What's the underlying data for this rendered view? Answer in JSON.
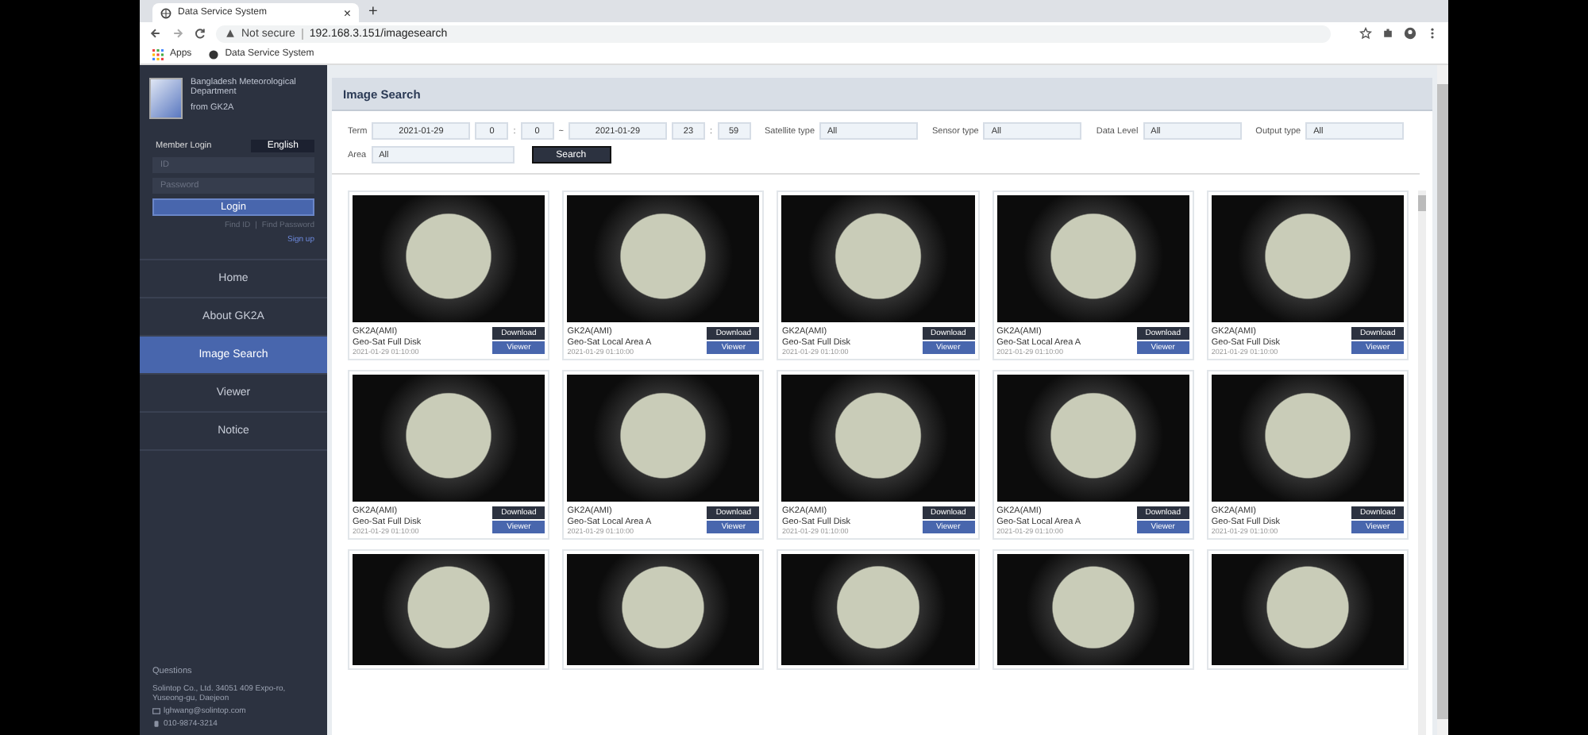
{
  "browser": {
    "tab_title": "Data Service System",
    "tab_close": "×",
    "new_tab": "+",
    "security": "Not secure",
    "url": "192.168.3.151/imagesearch",
    "bookmarks": [
      "Apps",
      "Data Service System"
    ]
  },
  "sidebar": {
    "org": "Bangladesh Meteorological Department",
    "sub": "from GK2A",
    "login_title": "Member Login",
    "language": "English",
    "id_placeholder": "ID",
    "password_placeholder": "Password",
    "login_button": "Login",
    "find_id": "Find ID",
    "find_sep": "|",
    "find_password": "Find Password",
    "sign_up": "Sign up",
    "menu": [
      {
        "label": "Home",
        "selected": false
      },
      {
        "label": "About GK2A",
        "selected": false
      },
      {
        "label": "Image Search",
        "selected": true
      },
      {
        "label": "Viewer",
        "selected": false
      },
      {
        "label": "Notice",
        "selected": false
      }
    ],
    "footer": {
      "title": "Questions",
      "address": "Solintop Co., Ltd. 34051 409 Expo-ro, Yuseong-gu, Daejeon",
      "email": "lghwang@solintop.com",
      "phone": "010-9874-3214"
    }
  },
  "main": {
    "title": "Image Search",
    "form": {
      "term_label": "Term",
      "start_date": "2021-01-29",
      "start_hour": "0",
      "start_min": "0",
      "range_sep": "~",
      "end_date": "2021-01-29",
      "end_hour": "23",
      "end_min": "59",
      "time_sep": ":",
      "selects": [
        {
          "label": "Satellite type",
          "value": "All"
        },
        {
          "label": "Sensor type",
          "value": "All"
        },
        {
          "label": "Data Level",
          "value": "All"
        },
        {
          "label": "Output type",
          "value": "All"
        }
      ],
      "area_label": "Area",
      "area_value": "All",
      "search_button": "Search"
    },
    "cards": [
      {
        "kind": "full",
        "sensor": "GK2A(AMI)",
        "area": "Geo-Sat Full Disk",
        "time": "2021-01-29 01:10:00",
        "download": "Download",
        "viewer": "Viewer"
      },
      {
        "kind": "full",
        "sensor": "GK2A(AMI)",
        "area": "Geo-Sat Local Area A",
        "time": "2021-01-29 01:10:00",
        "download": "Download",
        "viewer": "Viewer"
      },
      {
        "kind": "full",
        "sensor": "GK2A(AMI)",
        "area": "Geo-Sat Full Disk",
        "time": "2021-01-29 01:10:00",
        "download": "Download",
        "viewer": "Viewer"
      },
      {
        "kind": "full",
        "sensor": "GK2A(AMI)",
        "area": "Geo-Sat Local Area A",
        "time": "2021-01-29 01:10:00",
        "download": "Download",
        "viewer": "Viewer"
      },
      {
        "kind": "full",
        "sensor": "GK2A(AMI)",
        "area": "Geo-Sat Full Disk",
        "time": "2021-01-29 01:10:00",
        "download": "Download",
        "viewer": "Viewer"
      },
      {
        "kind": "full",
        "sensor": "GK2A(AMI)",
        "area": "Geo-Sat Full Disk",
        "time": "2021-01-29 01:10:00",
        "download": "Download",
        "viewer": "Viewer"
      },
      {
        "kind": "full",
        "sensor": "GK2A(AMI)",
        "area": "Geo-Sat Local Area A",
        "time": "2021-01-29 01:10:00",
        "download": "Download",
        "viewer": "Viewer"
      },
      {
        "kind": "full",
        "sensor": "GK2A(AMI)",
        "area": "Geo-Sat Full Disk",
        "time": "2021-01-29 01:10:00",
        "download": "Download",
        "viewer": "Viewer"
      },
      {
        "kind": "full",
        "sensor": "GK2A(AMI)",
        "area": "Geo-Sat Local Area A",
        "time": "2021-01-29 01:10:00",
        "download": "Download",
        "viewer": "Viewer"
      },
      {
        "kind": "full",
        "sensor": "GK2A(AMI)",
        "area": "Geo-Sat Full Disk",
        "time": "2021-01-29 01:10:00",
        "download": "Download",
        "viewer": "Viewer"
      },
      {
        "kind": "cut"
      },
      {
        "kind": "cut"
      },
      {
        "kind": "cut"
      },
      {
        "kind": "cut"
      },
      {
        "kind": "cut"
      }
    ]
  }
}
